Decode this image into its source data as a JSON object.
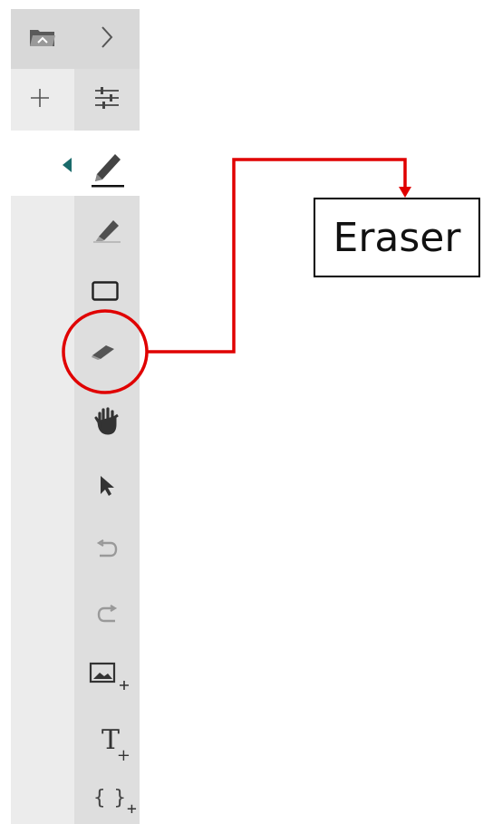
{
  "toolbar": {
    "items": [
      {
        "name": "open-folder",
        "icon": "folder-open-icon"
      },
      {
        "name": "expand",
        "icon": "chevron-right-icon"
      },
      {
        "name": "add",
        "icon": "plus-icon"
      },
      {
        "name": "settings",
        "icon": "sliders-icon"
      },
      {
        "name": "collapse",
        "icon": "triangle-left-icon"
      },
      {
        "name": "pen",
        "icon": "pen-icon",
        "selected": true
      },
      {
        "name": "highlighter",
        "icon": "highlighter-icon"
      },
      {
        "name": "shape",
        "icon": "rectangle-icon"
      },
      {
        "name": "eraser",
        "icon": "eraser-icon",
        "highlighted": true
      },
      {
        "name": "pan",
        "icon": "hand-icon"
      },
      {
        "name": "select",
        "icon": "cursor-arrow-icon"
      },
      {
        "name": "undo",
        "icon": "undo-icon"
      },
      {
        "name": "redo",
        "icon": "redo-icon"
      },
      {
        "name": "insert-image",
        "icon": "image-plus-icon"
      },
      {
        "name": "insert-text",
        "icon": "text-plus-icon",
        "glyph": "T",
        "sub": "+"
      },
      {
        "name": "insert-math",
        "icon": "braces-plus-icon",
        "glyph": "{ }",
        "sub": "+"
      }
    ]
  },
  "annotation": {
    "label": "Eraser",
    "color": "#e00000"
  },
  "colors": {
    "accent": "#1a6b6b",
    "annotation": "#e00000"
  }
}
